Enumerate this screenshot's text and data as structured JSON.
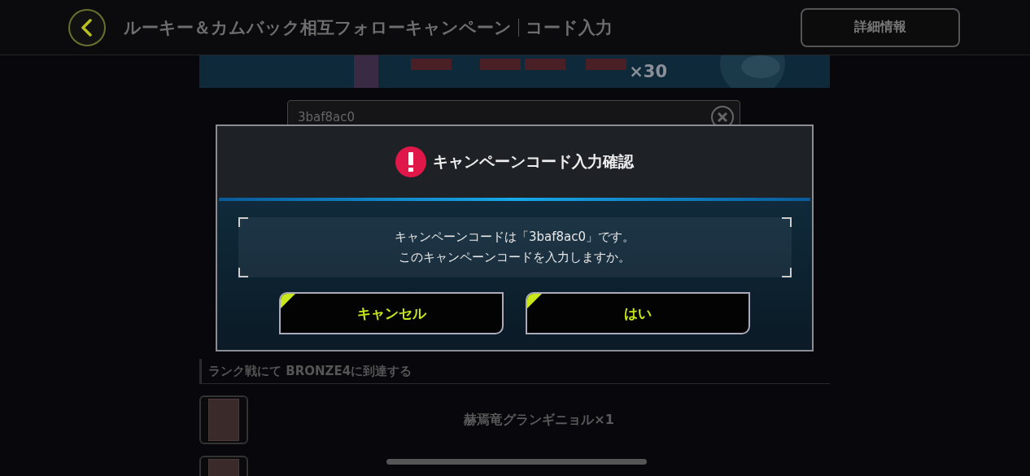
{
  "header": {
    "title": "ルーキー＆カムバック相互フォローキャンペーン",
    "subtitle": "コード入力",
    "detail_button": "詳細情報"
  },
  "banner": {
    "kind": "picture",
    "count": "×30"
  },
  "code_field": {
    "value": "3baf8ac0"
  },
  "mission": {
    "title": "ランク戦にて BRONZE4に到達する",
    "rewards": [
      {
        "label": "赫焉竜グランギニョル×1"
      }
    ]
  },
  "dialog": {
    "title": "キャンペーンコード入力確認",
    "message": [
      "キャンペーンコードは「3baf8ac0」です。",
      "このキャンペーンコードを入力しますか。"
    ],
    "buttons": [
      "キャンセル",
      "はい"
    ]
  }
}
